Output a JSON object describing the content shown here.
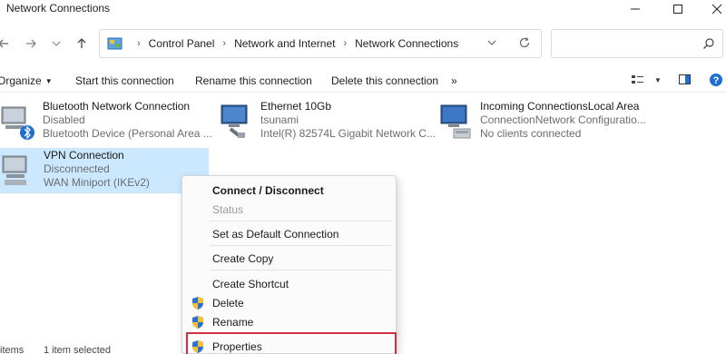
{
  "window": {
    "title": "Network Connections",
    "controls": {
      "minimize": "minimize-icon",
      "maximize": "maximize-icon",
      "close": "close-icon"
    }
  },
  "address": {
    "breadcrumbs": [
      "Control Panel",
      "Network and Internet",
      "Network Connections"
    ],
    "search_placeholder": ""
  },
  "toolbar": {
    "organize": "Organize",
    "start": "Start this connection",
    "rename": "Rename this connection",
    "delete": "Delete this connection",
    "more": "»"
  },
  "connections": [
    {
      "name": "Bluetooth Network Connection",
      "status": "Disabled",
      "device": "Bluetooth Device (Personal Area ..."
    },
    {
      "name": "Ethernet 10Gb",
      "status": "tsunami",
      "device": "Intel(R) 82574L Gigabit Network C..."
    },
    {
      "name": "Incoming ConnectionsLocal Area",
      "status": "ConnectionNetwork Configuratio...",
      "device": "No clients connected"
    },
    {
      "name": "VPN Connection",
      "status": "Disconnected",
      "device": "WAN Miniport (IKEv2)"
    }
  ],
  "context_menu": {
    "connect": "Connect / Disconnect",
    "status": "Status",
    "set_default": "Set as Default Connection",
    "create_copy": "Create Copy",
    "create_shortcut": "Create Shortcut",
    "delete": "Delete",
    "rename": "Rename",
    "properties": "Properties"
  },
  "statusbar": {
    "items": "items",
    "selected": "1 item selected"
  },
  "colors": {
    "selection": "#cce8ff",
    "highlight_box": "#d32f3f",
    "shield_blue": "#2f6fd0",
    "shield_yellow": "#f2c230"
  }
}
